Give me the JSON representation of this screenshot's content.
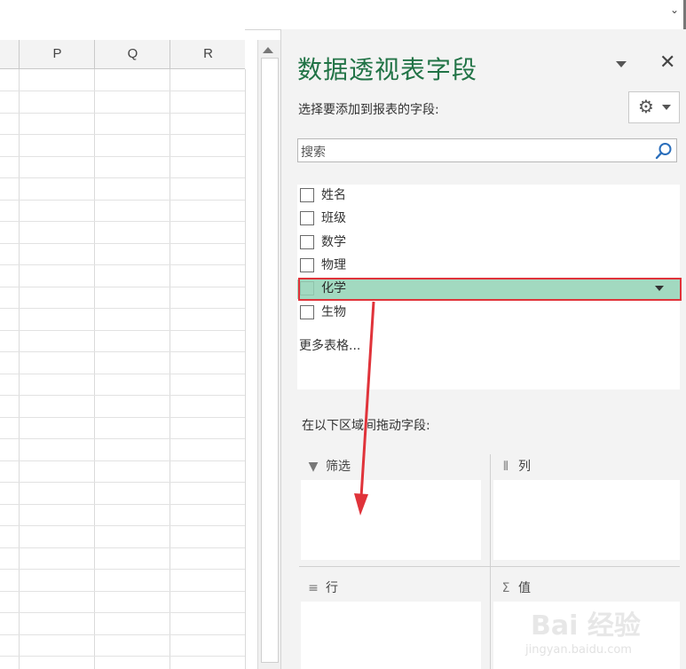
{
  "sheet": {
    "columns": [
      "P",
      "Q",
      "R"
    ]
  },
  "panel": {
    "title": "数据透视表字段",
    "choose_label": "选择要添加到报表的字段:",
    "search_placeholder": "搜索",
    "fields": [
      {
        "label": "姓名",
        "checked": false,
        "highlighted": false
      },
      {
        "label": "班级",
        "checked": false,
        "highlighted": false
      },
      {
        "label": "数学",
        "checked": false,
        "highlighted": false
      },
      {
        "label": "物理",
        "checked": false,
        "highlighted": false
      },
      {
        "label": "化学",
        "checked": false,
        "highlighted": true
      },
      {
        "label": "生物",
        "checked": false,
        "highlighted": false
      }
    ],
    "more_tables": "更多表格...",
    "drag_label": "在以下区域间拖动字段:",
    "areas": {
      "filter": "筛选",
      "columns": "列",
      "rows": "行",
      "values": "值"
    }
  },
  "colors": {
    "title_green": "#217346",
    "highlight": "#a2d9c0",
    "annotation_red": "#e0333a"
  },
  "watermark": {
    "text": "Bai 经验",
    "url": "jingyan.baidu.com"
  }
}
